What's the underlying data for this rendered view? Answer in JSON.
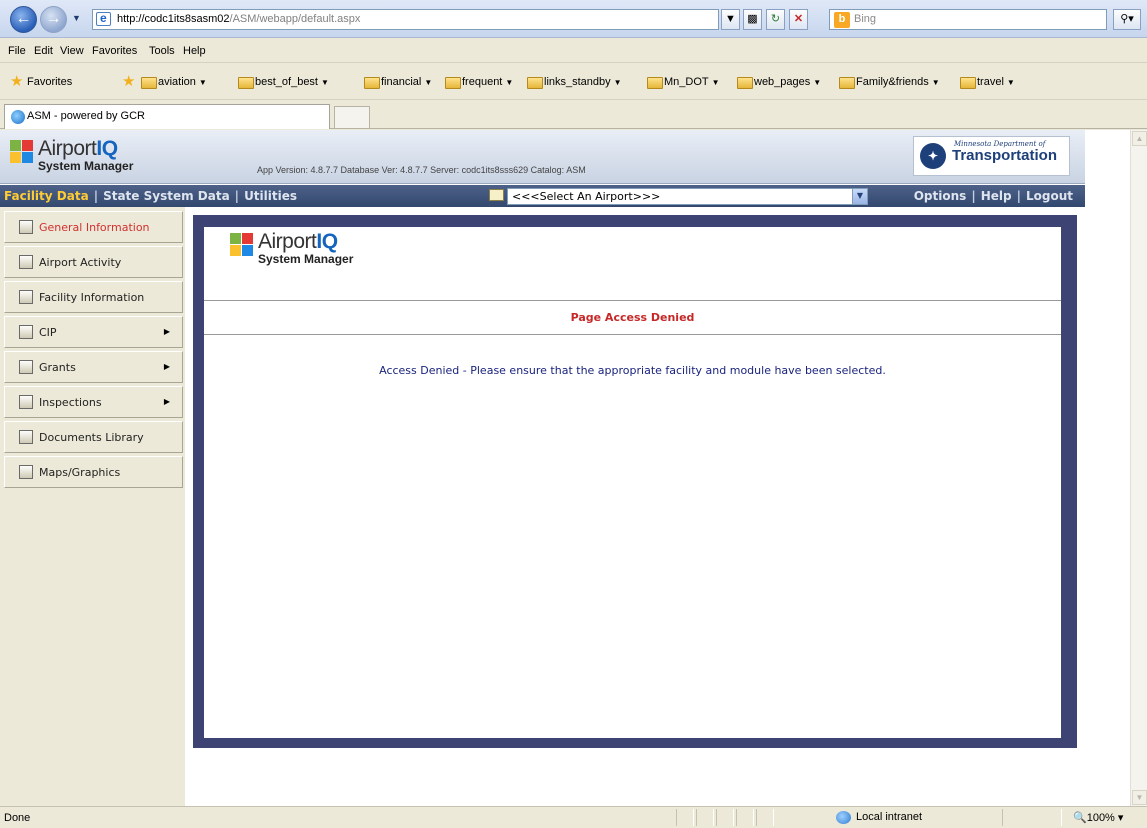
{
  "browser": {
    "url_host": "http://codc1its8sasm02",
    "url_path": "/ASM/webapp/default.aspx",
    "search_placeholder": "Bing",
    "menu": [
      "File",
      "Edit",
      "View",
      "Favorites",
      "Tools",
      "Help"
    ],
    "favorites_label": "Favorites",
    "favorites": [
      "aviation",
      "best_of_best",
      "financial",
      "frequent",
      "links_standby",
      "Mn_DOT",
      "web_pages",
      "Family&friends",
      "travel"
    ],
    "tab_title": "ASM - powered by GCR",
    "status_text": "Done",
    "zone": "Local intranet",
    "zoom": "100%"
  },
  "app": {
    "logo_word": "Airport",
    "logo_accent": "IQ",
    "logo_sub": "System Manager",
    "version_info": "App Version: 4.8.7.7 Database Ver: 4.8.7.7 Server: codc1its8sss629 Catalog: ASM",
    "dept_line1": "Minnesota Department of",
    "dept_line2": "Transportation",
    "nav_left": [
      "Facility Data",
      "State System Data",
      "Utilities"
    ],
    "airport_select": "<<<Select An Airport>>>",
    "nav_right": [
      "Options",
      "Help",
      "Logout"
    ]
  },
  "sidebar": {
    "items": [
      {
        "label": "General Information",
        "active": true,
        "submenu": false
      },
      {
        "label": "Airport Activity",
        "active": false,
        "submenu": false
      },
      {
        "label": "Facility Information",
        "active": false,
        "submenu": false
      },
      {
        "label": "CIP",
        "active": false,
        "submenu": true
      },
      {
        "label": "Grants",
        "active": false,
        "submenu": true
      },
      {
        "label": "Inspections",
        "active": false,
        "submenu": true
      },
      {
        "label": "Documents Library",
        "active": false,
        "submenu": false
      },
      {
        "label": "Maps/Graphics",
        "active": false,
        "submenu": false
      }
    ]
  },
  "main": {
    "page_title": "Page Access Denied",
    "message": "Access Denied - Please ensure that the appropriate facility and module have been selected."
  },
  "colors": {
    "accent_nav": "#33486f",
    "active_nav": "#ffcc33",
    "title_red": "#c62828",
    "message_blue": "#1a237e",
    "content_frame": "#3d4473"
  }
}
